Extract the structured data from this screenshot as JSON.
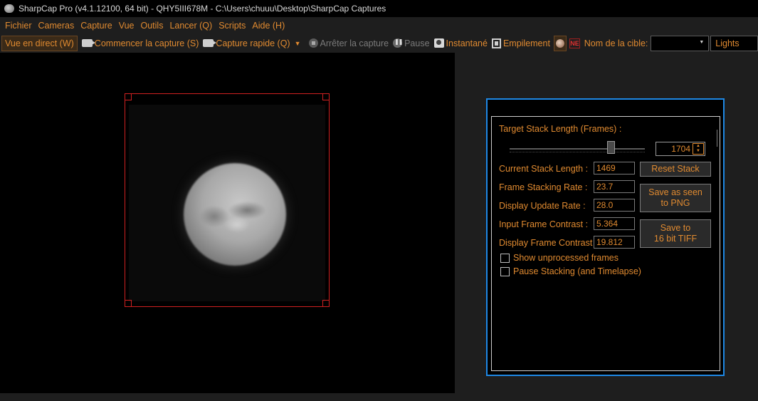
{
  "window": {
    "title": "SharpCap Pro (v4.1.12100, 64 bit) - QHY5III678M - C:\\Users\\chuuu\\Desktop\\SharpCap Captures"
  },
  "menu": {
    "items": [
      "Fichier",
      "Cameras",
      "Capture",
      "Vue",
      "Outils",
      "Lancer (Q)",
      "Scripts",
      "Aide (H)"
    ]
  },
  "toolbar": {
    "live_view": "Vue en direct (W)",
    "start_capture": "Commencer la capture (S)",
    "quick_capture": "Capture rapide (Q)",
    "stop_capture": "Arrêter la capture",
    "pause": "Pause",
    "snapshot": "Instantané",
    "stacking": "Empilement",
    "target_label": "Nom de la cible:",
    "target_value": "",
    "frame_type": "Lights"
  },
  "stack_panel": {
    "target_label": "Target Stack Length (Frames) :",
    "target_value": "1704",
    "slider_fraction": 0.75,
    "current_label": "Current Stack Length :",
    "current_value": "1469",
    "frame_rate_label": "Frame Stacking Rate :",
    "frame_rate_value": "23.7",
    "display_rate_label": "Display Update Rate :",
    "display_rate_value": "28.0",
    "input_contrast_label": "Input Frame Contrast :",
    "input_contrast_value": "5.364",
    "display_contrast_label": "Display Frame Contrast :",
    "display_contrast_value": "19.812",
    "reset_button": "Reset Stack",
    "save_png_line1": "Save as seen",
    "save_png_line2": "to PNG",
    "save_tiff_line1": "Save to",
    "save_tiff_line2": "16 bit TIFF",
    "show_unprocessed": "Show unprocessed frames",
    "pause_stacking": "Pause Stacking (and Timelapse)"
  },
  "colors": {
    "accent": "#e08a30",
    "panel_border": "#1e88e5",
    "roi_border": "#d02020"
  }
}
